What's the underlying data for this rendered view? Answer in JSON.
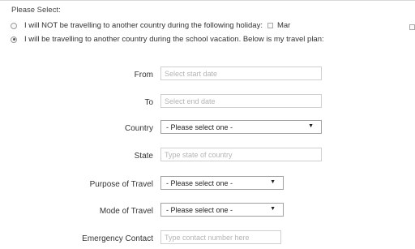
{
  "header": {
    "please_select": "Please Select:"
  },
  "options": {
    "not_travelling": {
      "label": "I will NOT be travelling to another country during the following holiday:",
      "selected": false,
      "holiday_month": "Mar"
    },
    "travelling": {
      "label": "I will be travelling to another country during the school vacation. Below is my travel plan:",
      "selected": true
    }
  },
  "form": {
    "from": {
      "label": "From",
      "placeholder": "Select start date",
      "value": ""
    },
    "to": {
      "label": "To",
      "placeholder": "Select end date",
      "value": ""
    },
    "country": {
      "label": "Country",
      "selected": "- Please select one -"
    },
    "state": {
      "label": "State",
      "placeholder": "Type state of country",
      "value": ""
    },
    "purpose": {
      "label": "Purpose of Travel",
      "selected": "- Please select one -"
    },
    "mode": {
      "label": "Mode of Travel",
      "selected": "- Please select one -"
    },
    "emergency": {
      "label": "Emergency Contact",
      "placeholder": "Type contact number here",
      "value": ""
    }
  },
  "icons": {
    "dropdown": "caret-down-icon",
    "dropdown_glyph": "▼"
  }
}
